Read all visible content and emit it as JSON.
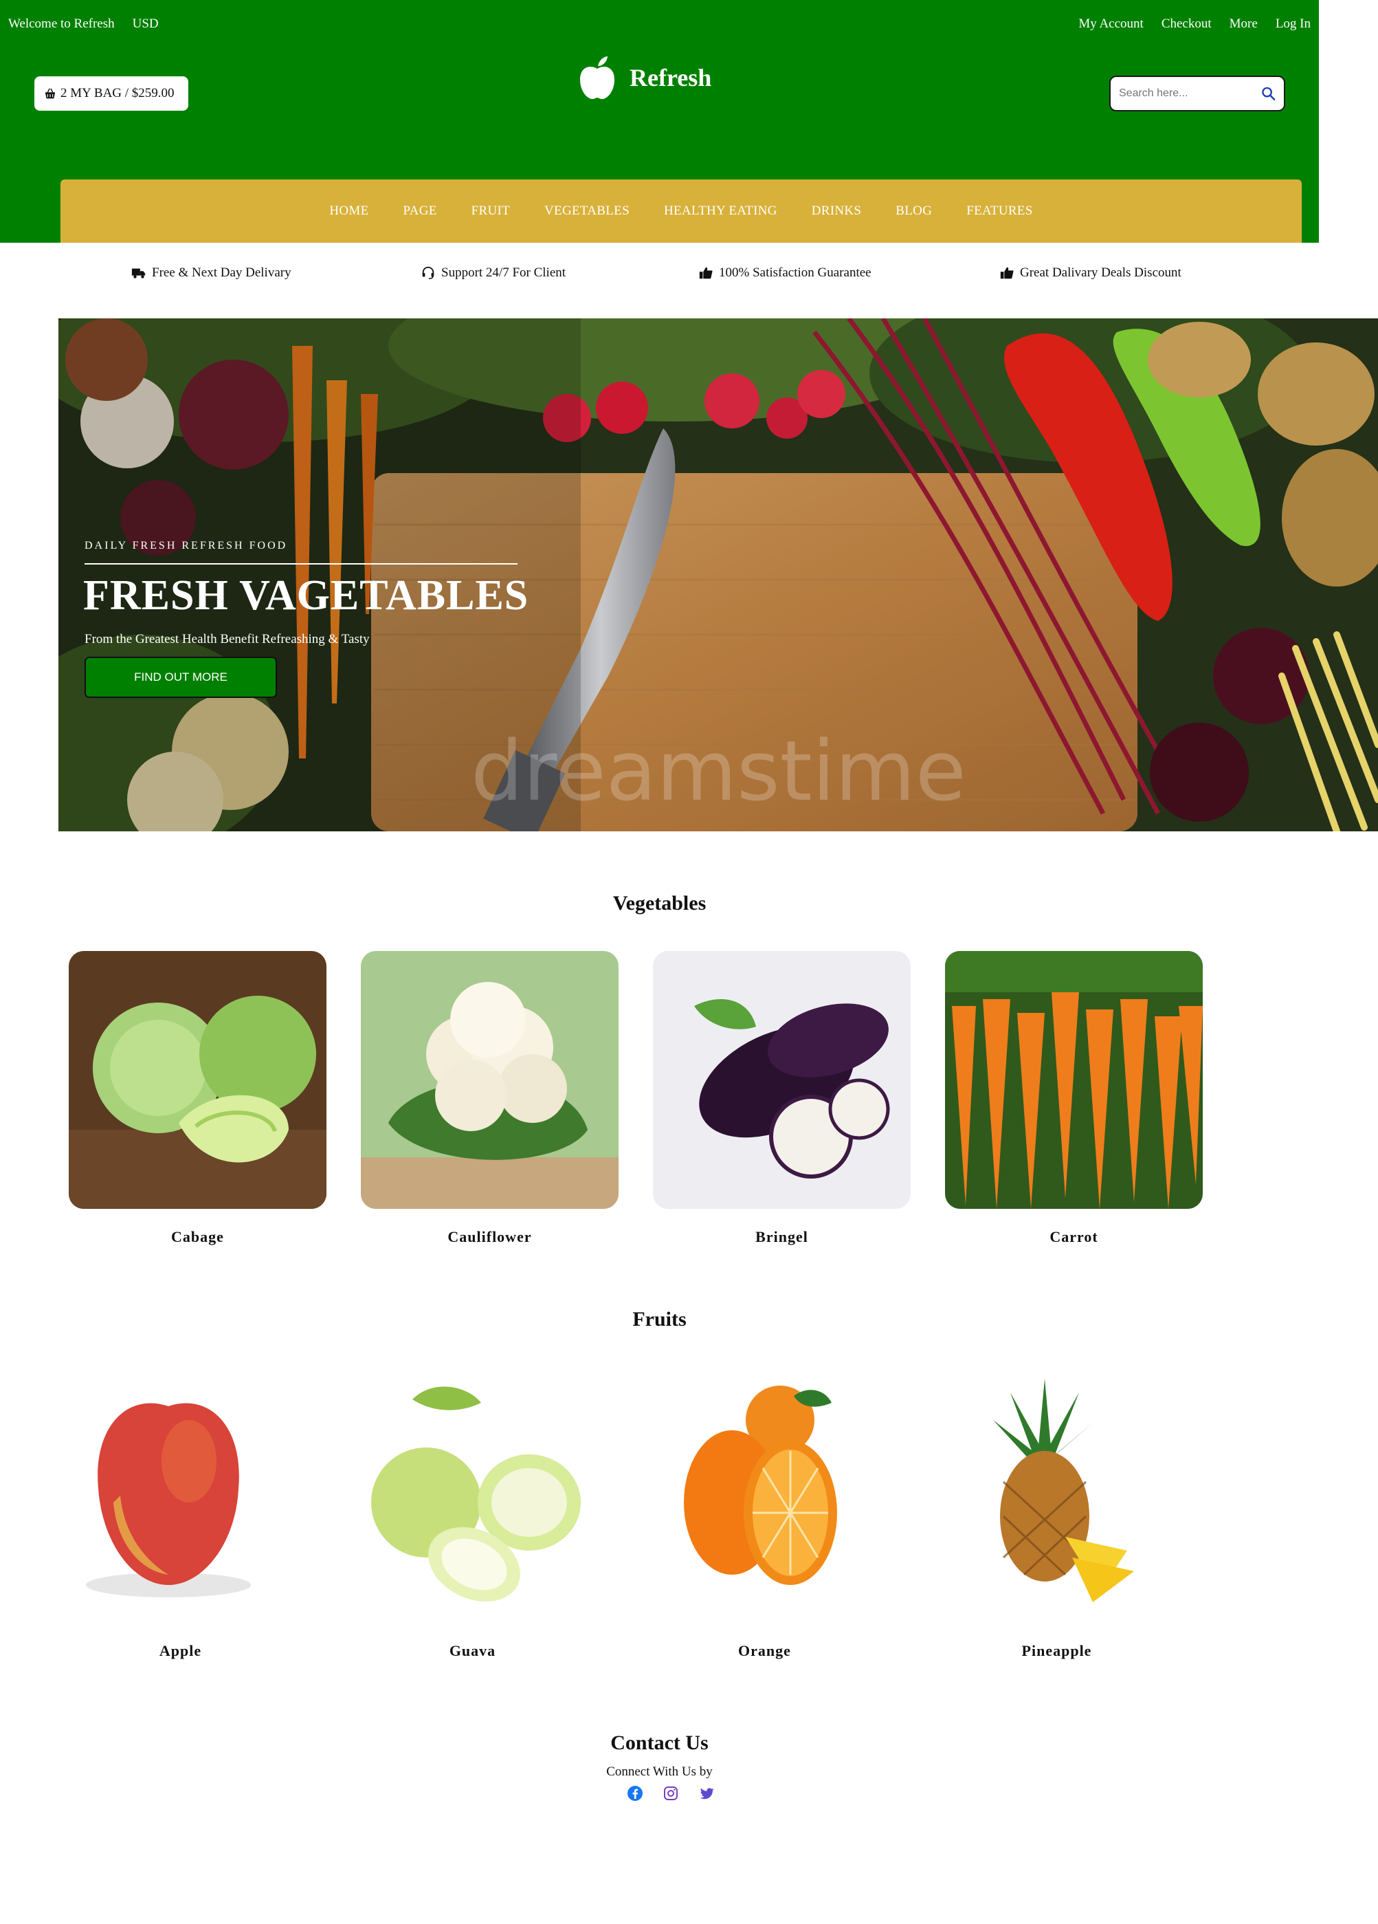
{
  "topbar": {
    "welcome": "Welcome to Refresh",
    "currency": "USD",
    "links": [
      "My Account",
      "Checkout",
      "More",
      "Log In"
    ]
  },
  "bag": {
    "label": "2 MY BAG / $259.00"
  },
  "brand": {
    "name": "Refresh",
    "logo_icon": "apple-icon"
  },
  "search": {
    "placeholder": "Search here..."
  },
  "nav": [
    "HOME",
    "PAGE",
    "FRUIT",
    "VEGETABLES",
    "HEALTHY EATING",
    "DRINKS",
    "BLOG",
    "FEATURES"
  ],
  "features": [
    {
      "icon": "truck-icon",
      "text": "Free & Next Day Delivary"
    },
    {
      "icon": "headset-icon",
      "text": "Support 24/7 For Client"
    },
    {
      "icon": "thumbs-up-icon",
      "text": "100% Satisfaction Guarantee"
    },
    {
      "icon": "thumbs-up-icon",
      "text": "Great Dalivary Deals Discount"
    }
  ],
  "hero": {
    "eyebrow": "DAILY FRESH REFRESH FOOD",
    "title": "FRESH VAGETABLES",
    "subtitle": "From the Greatest Health Benefit Refreashing & Tasty",
    "button": "FIND OUT MORE",
    "watermark": "dreamstime"
  },
  "vegetables": {
    "title": "Vegetables",
    "items": [
      "Cabage",
      "Cauliflower",
      "Bringel",
      "Carrot"
    ]
  },
  "fruits": {
    "title": "Fruits",
    "items": [
      "Apple",
      "Guava",
      "Orange",
      "Pineapple"
    ]
  },
  "contact": {
    "title": "Contact Us",
    "subtitle": "Connect With Us by",
    "icons": [
      "facebook-icon",
      "instagram-icon",
      "twitter-icon"
    ]
  },
  "colors": {
    "header": "#008000",
    "nav": "#d8b13a",
    "button": "#008000"
  }
}
